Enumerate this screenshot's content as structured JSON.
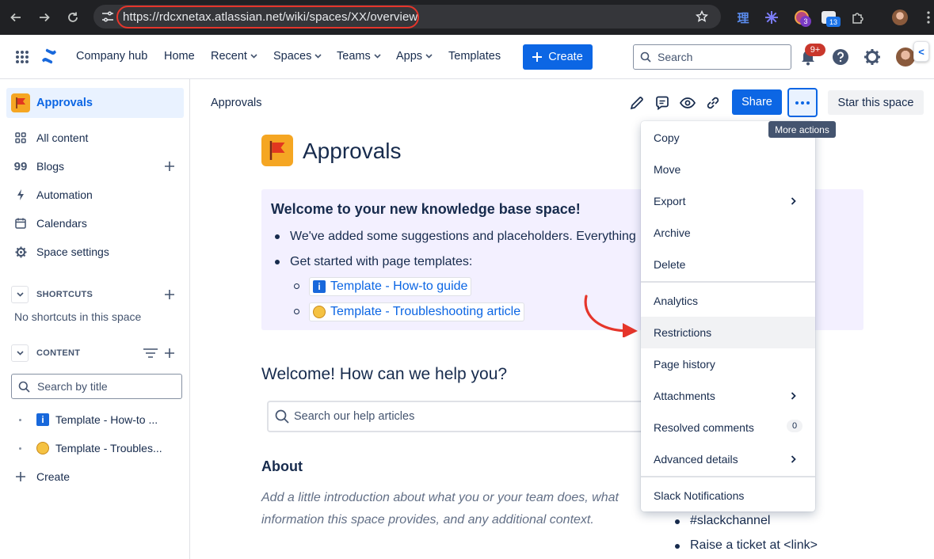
{
  "browser": {
    "url": "https://rdcxnetax.atlassian.net/wiki/spaces/XX/overview",
    "ext_badge_1": "3",
    "ext_badge_2": "13",
    "ext_glyph_1": "理"
  },
  "header": {
    "nav": [
      "Company hub",
      "Home",
      "Recent",
      "Spaces",
      "Teams",
      "Apps",
      "Templates"
    ],
    "create_label": "Create",
    "search_placeholder": "Search",
    "notifications_badge": "9+",
    "collapse_glyph": "<"
  },
  "sidebar": {
    "space_name": "Approvals",
    "items": [
      {
        "label": "All content",
        "icon": "grid-icon"
      },
      {
        "label": "Blogs",
        "icon": "quote-icon"
      },
      {
        "label": "Automation",
        "icon": "lightning-icon"
      },
      {
        "label": "Calendars",
        "icon": "calendar-icon"
      },
      {
        "label": "Space settings",
        "icon": "gear-icon"
      }
    ],
    "shortcuts_heading": "SHORTCUTS",
    "shortcuts_empty": "No shortcuts in this space",
    "content_heading": "CONTENT",
    "search_placeholder": "Search by title",
    "tree": [
      "Template - How-to ...",
      "Template - Troubles..."
    ],
    "create_label": "Create"
  },
  "main": {
    "breadcrumb": "Approvals",
    "share_label": "Share",
    "star_label": "Star this space",
    "tooltip": "More actions",
    "title": "Approvals",
    "panel": {
      "heading": "Welcome to your new knowledge base space!",
      "bullet1": "We've added some suggestions and placeholders. Everything",
      "bullet2": "Get started with page templates:",
      "links": [
        "Template - How-to guide",
        "Template - Troubleshooting article"
      ]
    },
    "help_heading": "Welcome! How can we help you?",
    "help_search_placeholder": "Search our help articles",
    "about_heading": "About",
    "about_text_1": "Add a little introduction about what you or your team does, what",
    "about_text_2": "information this space provides, and any additional context.",
    "right_bullets": [
      "#slackchannel",
      "Raise a ticket at <link>"
    ]
  },
  "menu": {
    "group1": [
      {
        "label": "Copy"
      },
      {
        "label": "Move"
      },
      {
        "label": "Export",
        "submenu": true
      },
      {
        "label": "Archive"
      },
      {
        "label": "Delete"
      }
    ],
    "group2": [
      {
        "label": "Analytics"
      },
      {
        "label": "Restrictions",
        "highlighted": true
      },
      {
        "label": "Page history"
      },
      {
        "label": "Attachments",
        "submenu": true
      },
      {
        "label": "Resolved comments",
        "count": "0"
      },
      {
        "label": "Advanced details",
        "submenu": true
      }
    ],
    "group3": [
      {
        "label": "Slack Notifications"
      }
    ]
  },
  "colors": {
    "brand_blue": "#0c66e4",
    "annotation_red": "#e5352b",
    "panel_bg": "#f3f0ff",
    "selected_bg": "#e9f2ff"
  }
}
